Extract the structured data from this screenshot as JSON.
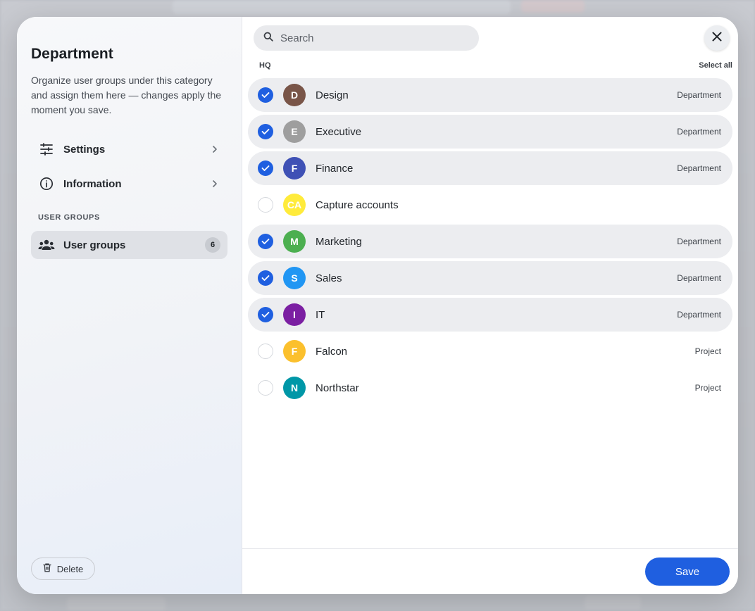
{
  "sidebar": {
    "title": "Department",
    "description": "Organize user groups under this category and assign them here — changes apply the moment you save.",
    "nav": {
      "settings": {
        "label": "Settings",
        "icon": "sliders-icon"
      },
      "information": {
        "label": "Information",
        "icon": "info-icon"
      }
    },
    "section_label": "USER GROUPS",
    "user_groups": {
      "label": "User groups",
      "count": "6",
      "icon": "people-icon"
    },
    "delete_label": "Delete"
  },
  "search": {
    "placeholder": "Search",
    "value": ""
  },
  "list": {
    "group_label": "HQ",
    "select_all_label": "Select all",
    "items": [
      {
        "initials": "D",
        "name": "Design",
        "type": "Department",
        "checked": true,
        "color": "#795548"
      },
      {
        "initials": "E",
        "name": "Executive",
        "type": "Department",
        "checked": true,
        "color": "#9e9e9e"
      },
      {
        "initials": "F",
        "name": "Finance",
        "type": "Department",
        "checked": true,
        "color": "#3f51b5"
      },
      {
        "initials": "CA",
        "name": "Capture accounts",
        "type": "",
        "checked": false,
        "color": "#ffeb3b"
      },
      {
        "initials": "M",
        "name": "Marketing",
        "type": "Department",
        "checked": true,
        "color": "#4caf50"
      },
      {
        "initials": "S",
        "name": "Sales",
        "type": "Department",
        "checked": true,
        "color": "#2196f3"
      },
      {
        "initials": "I",
        "name": "IT",
        "type": "Department",
        "checked": true,
        "color": "#7b1fa2"
      },
      {
        "initials": "F",
        "name": "Falcon",
        "type": "Project",
        "checked": false,
        "color": "#fbc02d"
      },
      {
        "initials": "N",
        "name": "Northstar",
        "type": "Project",
        "checked": false,
        "color": "#0097a7"
      }
    ]
  },
  "footer": {
    "save_label": "Save"
  },
  "colors": {
    "accent": "#1f5fe0"
  }
}
